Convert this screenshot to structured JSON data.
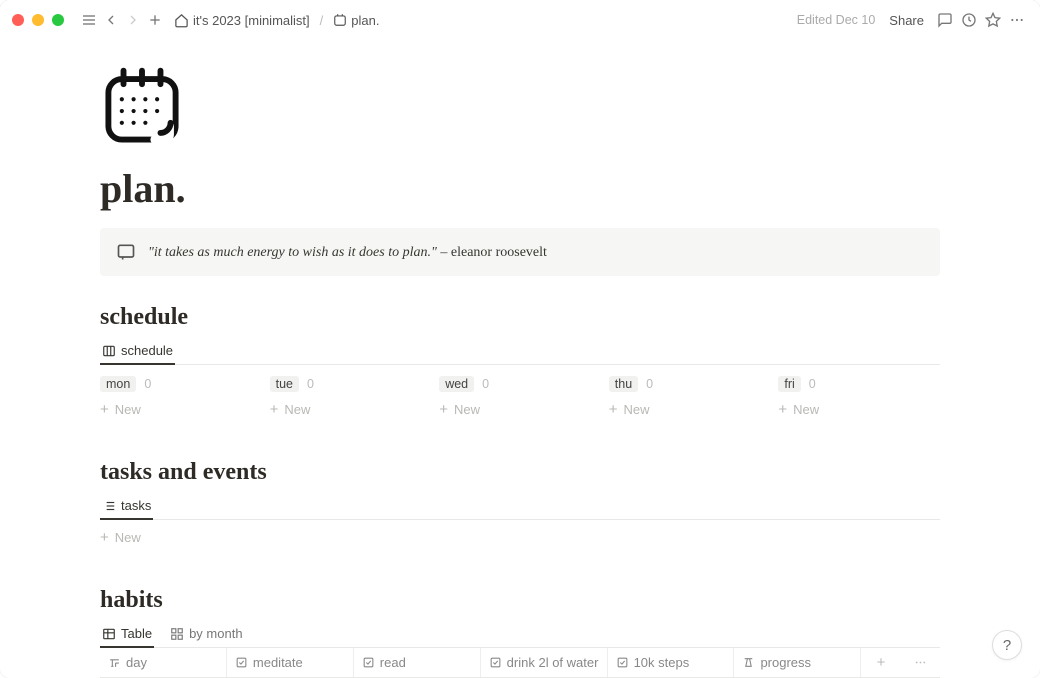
{
  "topbar": {
    "breadcrumb_parent": "it's 2023 [minimalist]",
    "breadcrumb_current": "plan.",
    "edited": "Edited Dec 10",
    "share": "Share"
  },
  "page": {
    "title": "plan.",
    "callout_quote": "\"it takes as much energy to wish as it does to plan.\"",
    "callout_attrib": " – eleanor roosevelt"
  },
  "schedule": {
    "heading": "schedule",
    "tab_label": "schedule",
    "new_label": "New",
    "columns": [
      {
        "label": "mon",
        "count": "0"
      },
      {
        "label": "tue",
        "count": "0"
      },
      {
        "label": "wed",
        "count": "0"
      },
      {
        "label": "thu",
        "count": "0"
      },
      {
        "label": "fri",
        "count": "0"
      }
    ]
  },
  "tasks": {
    "heading": "tasks and events",
    "tab_label": "tasks",
    "new_label": "New"
  },
  "habits": {
    "heading": "habits",
    "tab_table": "Table",
    "tab_month": "by month",
    "columns": {
      "day": "day",
      "meditate": "meditate",
      "read": "read",
      "water": "drink 2l of water",
      "steps": "10k steps",
      "progress": "progress"
    }
  },
  "help": "?"
}
